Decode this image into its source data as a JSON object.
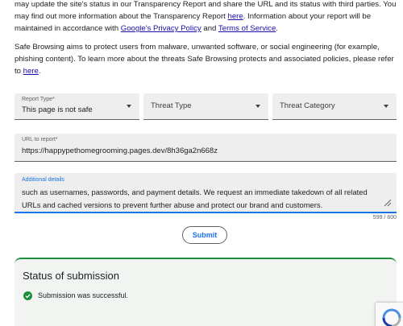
{
  "intro": {
    "para1_text_a": "may update the site's status in our Transparency Report and share the URL and its status with third parties. You may find out more information about the Transparency Report ",
    "para1_link_here": "here",
    "para1_text_b": ". Information about your report will be maintained in accordance with ",
    "para1_link_privacy": "Google's Privacy Policy",
    "para1_text_c": " and ",
    "para1_link_terms": "Terms of Service",
    "para1_text_d": ".",
    "para2_text_a": "Safe Browsing aims to protect users from malware, unwanted software, or social engineering (for example, phishing content). To learn more about the threats Safe Browsing protects and associated policies, please refer to ",
    "para2_link_here": "here",
    "para2_text_b": "."
  },
  "form": {
    "report_type": {
      "label": "Report Type*",
      "value": "This page is not safe"
    },
    "threat_type": {
      "placeholder": "Threat Type"
    },
    "threat_category": {
      "placeholder": "Threat Category"
    },
    "url": {
      "label": "URL to report*",
      "value": "https://happypethomegrooming.pages.dev/8h36ga2n668z"
    },
    "details": {
      "label": "Additional details",
      "value": "such as usernames, passwords, and payment details. We request an immediate takedown of all related URLs and cached versions to prevent further abuse and protect our brand and customers.",
      "char_count": "599 / 800"
    },
    "submit_label": "Submit"
  },
  "status": {
    "title": "Status of submission",
    "message": "Submission was successful."
  },
  "colors": {
    "accent": "#1a73e8",
    "success": "#1e8e3e",
    "link": "#1a0dab"
  },
  "icons": [
    "caret-down-icon",
    "resize-grip-icon",
    "check-circle-icon",
    "recaptcha-icon"
  ]
}
